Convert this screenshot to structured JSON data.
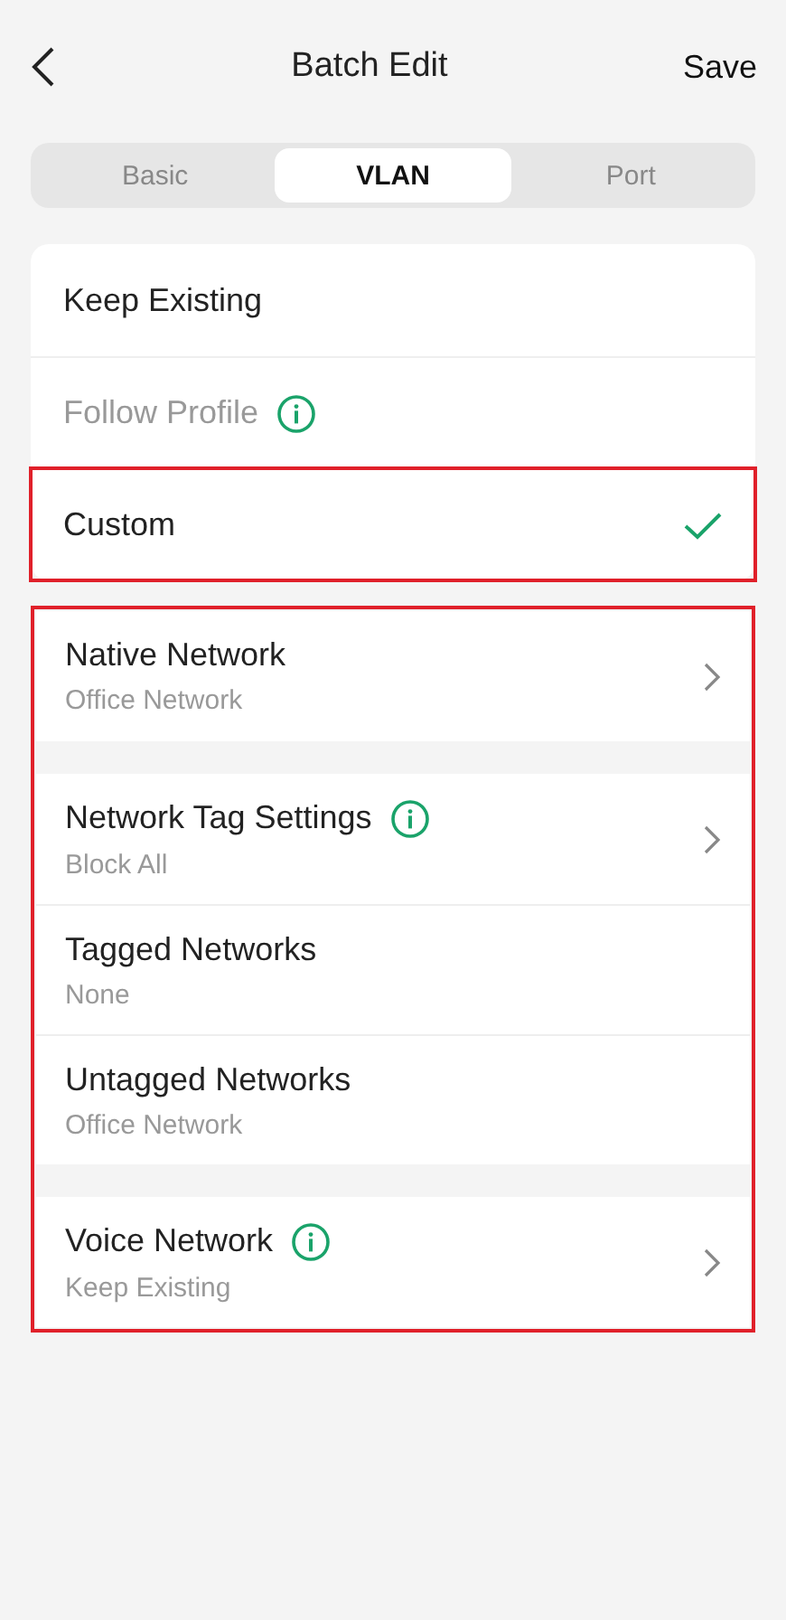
{
  "header": {
    "title": "Batch Edit",
    "action": "Save"
  },
  "tabs": [
    {
      "label": "Basic",
      "selected": false
    },
    {
      "label": "VLAN",
      "selected": true
    },
    {
      "label": "Port",
      "selected": false
    }
  ],
  "modes": [
    {
      "label": "Keep Existing",
      "selected": false,
      "disabled": false,
      "info": false,
      "highlighted": false
    },
    {
      "label": "Follow Profile",
      "selected": false,
      "disabled": true,
      "info": true,
      "highlighted": false
    },
    {
      "label": "Custom",
      "selected": true,
      "disabled": false,
      "info": false,
      "highlighted": true
    }
  ],
  "settings": {
    "highlighted": true,
    "groups": [
      {
        "items": [
          {
            "label": "Native Network",
            "value": "Office Network",
            "info": false,
            "chevron": true
          }
        ]
      },
      {
        "items": [
          {
            "label": "Network Tag Settings",
            "value": "Block All",
            "info": true,
            "chevron": true
          },
          {
            "label": "Tagged Networks",
            "value": "None",
            "info": false,
            "chevron": false
          },
          {
            "label": "Untagged Networks",
            "value": "Office Network",
            "info": false,
            "chevron": false
          }
        ]
      },
      {
        "items": [
          {
            "label": "Voice Network",
            "value": "Keep Existing",
            "info": true,
            "chevron": true
          }
        ]
      }
    ]
  }
}
